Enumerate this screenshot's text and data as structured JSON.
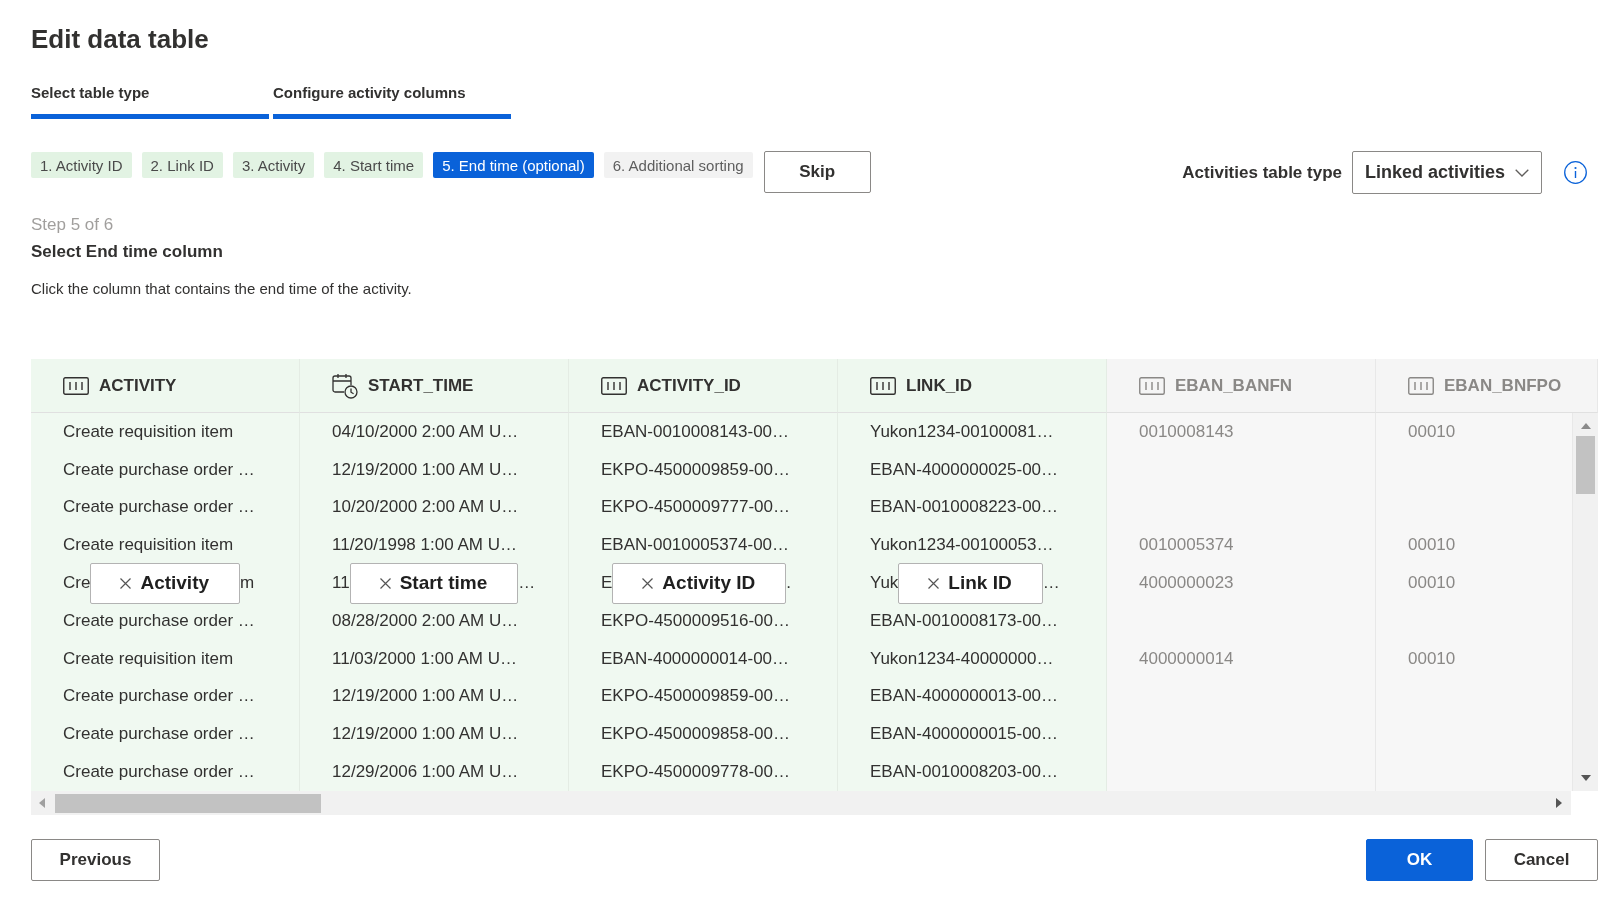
{
  "title": "Edit data table",
  "tabs": [
    {
      "label": "Select table type",
      "active": true
    },
    {
      "label": "Configure activity columns",
      "active": true
    }
  ],
  "steps": [
    {
      "label": "1. Activity ID",
      "done": true,
      "selected": false
    },
    {
      "label": "2. Link ID",
      "done": true,
      "selected": false
    },
    {
      "label": "3. Activity",
      "done": true,
      "selected": false
    },
    {
      "label": "4. Start time",
      "done": true,
      "selected": false
    },
    {
      "label": "5. End time (optional)",
      "done": false,
      "selected": true
    },
    {
      "label": "6. Additional sorting",
      "done": false,
      "selected": false
    }
  ],
  "skip_button": "Skip",
  "table_type": {
    "label": "Activities table type",
    "value": "Linked activities"
  },
  "instructions": {
    "step": "Step 5 of 6",
    "heading": "Select End time column",
    "description": "Click the column that contains the end time of the activity."
  },
  "table": {
    "columns": [
      {
        "name": "ACTIVITY",
        "kind": "text",
        "mapped": true
      },
      {
        "name": "START_TIME",
        "kind": "datetime",
        "mapped": true
      },
      {
        "name": "ACTIVITY_ID",
        "kind": "text",
        "mapped": true
      },
      {
        "name": "LINK_ID",
        "kind": "text",
        "mapped": true
      },
      {
        "name": "EBAN_BANFN",
        "kind": "text",
        "mapped": false
      },
      {
        "name": "EBAN_BNFPO",
        "kind": "text",
        "mapped": false
      }
    ],
    "rows": [
      {
        "cells": [
          {
            "text": "Create requisition item"
          },
          {
            "text": "04/10/2000 2:00 AM U…"
          },
          {
            "text": "EBAN-0010008143-00…"
          },
          {
            "text": "Yukon1234-00100081…"
          },
          {
            "text": "0010008143"
          },
          {
            "text": "00010"
          }
        ]
      },
      {
        "cells": [
          {
            "text": "Create purchase order …"
          },
          {
            "text": "12/19/2000 1:00 AM U…"
          },
          {
            "text": "EKPO-4500009859-00…"
          },
          {
            "text": "EBAN-4000000025-00…"
          },
          null,
          null
        ]
      },
      {
        "cells": [
          {
            "text": "Create purchase order …"
          },
          {
            "text": "10/20/2000 2:00 AM U…"
          },
          {
            "text": "EKPO-4500009777-00…"
          },
          {
            "text": "EBAN-0010008223-00…"
          },
          null,
          null
        ]
      },
      {
        "cells": [
          {
            "text": "Create requisition item"
          },
          {
            "text": "11/20/1998 1:00 AM U…"
          },
          {
            "text": "EBAN-0010005374-00…"
          },
          {
            "text": "Yukon1234-00100053…"
          },
          {
            "text": "0010005374"
          },
          {
            "text": "00010"
          }
        ]
      },
      {
        "cells": [
          {
            "text": "Cre",
            "tag": "Activity",
            "text_after": "m"
          },
          {
            "text": "11",
            "tag": "Start time",
            "text_after": "…"
          },
          {
            "text": "E",
            "tag": "Activity ID",
            "text_after": "."
          },
          {
            "text": "Yuk",
            "tag": "Link ID",
            "text_after": "…"
          },
          {
            "text": "4000000023"
          },
          {
            "text": "00010"
          }
        ]
      },
      {
        "cells": [
          {
            "text": "Create purchase order …"
          },
          {
            "text": "08/28/2000 2:00 AM U…"
          },
          {
            "text": "EKPO-4500009516-00…"
          },
          {
            "text": "EBAN-0010008173-00…"
          },
          null,
          null
        ]
      },
      {
        "cells": [
          {
            "text": "Create requisition item"
          },
          {
            "text": "11/03/2000 1:00 AM U…"
          },
          {
            "text": "EBAN-4000000014-00…"
          },
          {
            "text": "Yukon1234-40000000…"
          },
          {
            "text": "4000000014"
          },
          {
            "text": "00010"
          }
        ]
      },
      {
        "cells": [
          {
            "text": "Create purchase order …"
          },
          {
            "text": "12/19/2000 1:00 AM U…"
          },
          {
            "text": "EKPO-4500009859-00…"
          },
          {
            "text": "EBAN-4000000013-00…"
          },
          null,
          null
        ]
      },
      {
        "cells": [
          {
            "text": "Create purchase order …"
          },
          {
            "text": "12/19/2000 1:00 AM U…"
          },
          {
            "text": "EKPO-4500009858-00…"
          },
          {
            "text": "EBAN-4000000015-00…"
          },
          null,
          null
        ]
      },
      {
        "cells": [
          {
            "text": "Create purchase order …"
          },
          {
            "text": "12/29/2006 1:00 AM U…"
          },
          {
            "text": "EKPO-4500009778-00…"
          },
          {
            "text": "EBAN-0010008203-00…"
          },
          null,
          null
        ]
      }
    ]
  },
  "footer": {
    "back_button": "Previous",
    "buttons": [
      {
        "label": "OK",
        "kind": "primary"
      },
      {
        "label": "Cancel",
        "kind": "default"
      }
    ]
  }
}
